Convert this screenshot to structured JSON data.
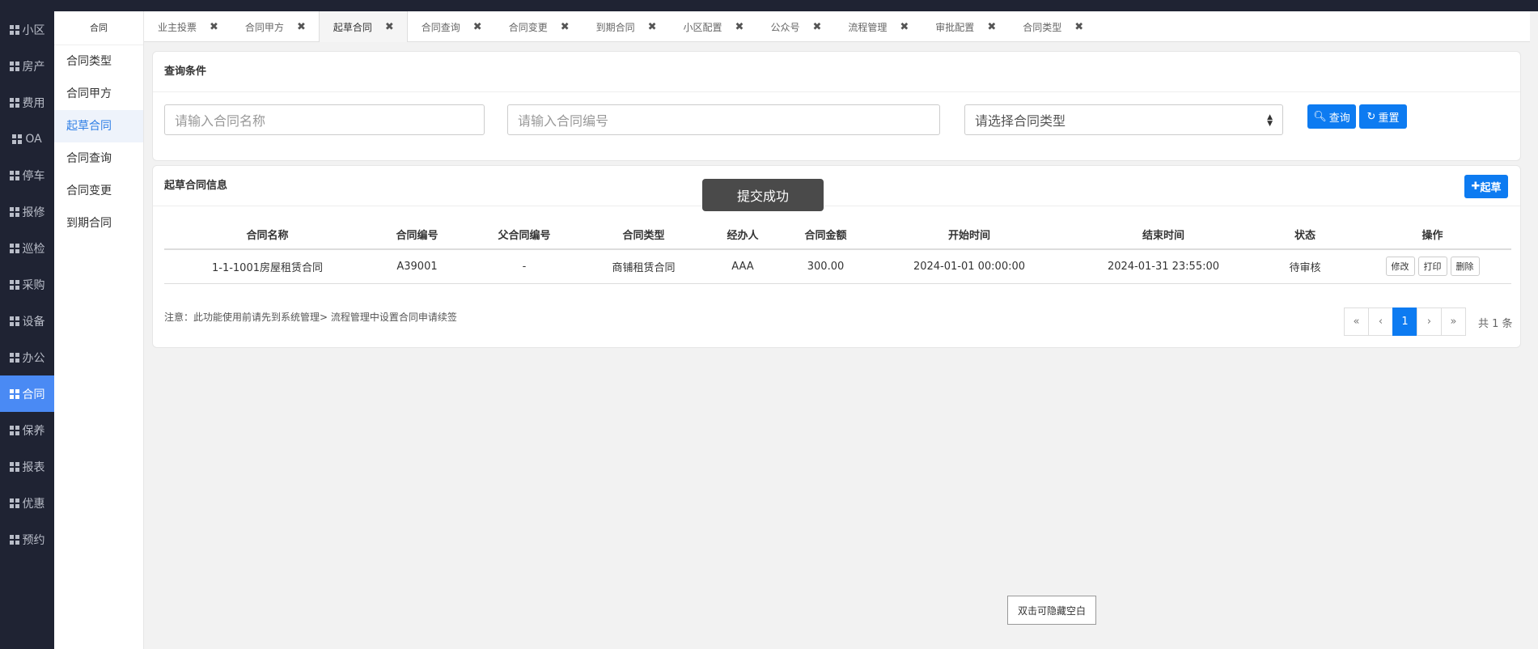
{
  "leftnav": {
    "items": [
      {
        "label": "小区"
      },
      {
        "label": "房产"
      },
      {
        "label": "费用"
      },
      {
        "label": "OA"
      },
      {
        "label": "停车"
      },
      {
        "label": "报修"
      },
      {
        "label": "巡检"
      },
      {
        "label": "采购"
      },
      {
        "label": "设备"
      },
      {
        "label": "办公"
      },
      {
        "label": "合同"
      },
      {
        "label": "保养"
      },
      {
        "label": "报表"
      },
      {
        "label": "优惠"
      },
      {
        "label": "预约"
      }
    ],
    "active_index": 10
  },
  "submenu": {
    "title": "合同",
    "items": [
      {
        "label": "合同类型"
      },
      {
        "label": "合同甲方"
      },
      {
        "label": "起草合同"
      },
      {
        "label": "合同查询"
      },
      {
        "label": "合同变更"
      },
      {
        "label": "到期合同"
      }
    ],
    "active_index": 2
  },
  "tabs": [
    {
      "label": "业主投票"
    },
    {
      "label": "合同甲方"
    },
    {
      "label": "起草合同"
    },
    {
      "label": "合同查询"
    },
    {
      "label": "合同变更"
    },
    {
      "label": "到期合同"
    },
    {
      "label": "小区配置"
    },
    {
      "label": "公众号"
    },
    {
      "label": "流程管理"
    },
    {
      "label": "审批配置"
    },
    {
      "label": "合同类型"
    }
  ],
  "tab_close_symbol": "✖",
  "query_panel": {
    "title": "查询条件",
    "name_placeholder": "请输入合同名称",
    "code_placeholder": "请输入合同编号",
    "type_select": "请选择合同类型",
    "search_label": "查询",
    "reset_label": "重置"
  },
  "list_panel": {
    "title": "起草合同信息",
    "add_label": "起草",
    "columns": [
      "合同名称",
      "合同编号",
      "父合同编号",
      "合同类型",
      "经办人",
      "合同金额",
      "开始时间",
      "结束时间",
      "状态",
      "操作"
    ],
    "rows": [
      {
        "name": "1-1-1001房屋租赁合同",
        "code": "A39001",
        "parent_code": "-",
        "type": "商铺租赁合同",
        "handler": "AAA",
        "amount": "300.00",
        "start": "2024-01-01 00:00:00",
        "end": "2024-01-31 23:55:00",
        "status": "待审核",
        "actions": [
          "修改",
          "打印",
          "删除"
        ]
      }
    ],
    "note": "注意：此功能使用前请先到系统管理> 流程管理中设置合同申请续签",
    "pager": {
      "first": "«",
      "prev": "‹",
      "current": "1",
      "next": "›",
      "last": "»",
      "total": "共 1 条"
    }
  },
  "toast": "提交成功",
  "hint_button": "双击可隐藏空白",
  "colors": {
    "accent": "#0d7bf1",
    "nav_bg": "#1f2333",
    "nav_active": "#4a8af4"
  }
}
